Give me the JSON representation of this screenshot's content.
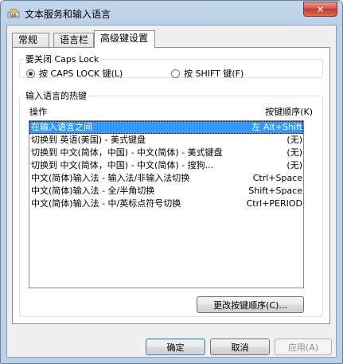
{
  "window": {
    "title": "文本服务和输入语言",
    "close_label": "✕"
  },
  "tabs": [
    {
      "label": "常规",
      "active": false
    },
    {
      "label": "语言栏",
      "active": false
    },
    {
      "label": "高级键设置",
      "active": true
    }
  ],
  "caps_lock": {
    "legend": "要关闭 Caps Lock",
    "option1": "按 CAPS LOCK 键(L)",
    "option2": "按 SHIFT 键(F)",
    "selected": "option1"
  },
  "hotkeys": {
    "legend": "输入语言的热键",
    "col_action": "操作",
    "col_sequence": "按键顺序(K)",
    "rows": [
      {
        "action": "在输入语言之间",
        "keys": "左 Alt+Shift",
        "selected": true
      },
      {
        "action": "切换到 英语(美国) - 美式键盘",
        "keys": "(无)",
        "selected": false
      },
      {
        "action": "切换到 中文(简体，中国) - 中文(简体) - 美式键盘",
        "keys": "(无)",
        "selected": false
      },
      {
        "action": "切换到 中文(简体，中国) - 中文(简体) - 搜狗...",
        "keys": "(无)",
        "selected": false
      },
      {
        "action": "中文(简体)输入法 - 输入法/非输入法切换",
        "keys": "Ctrl+Space",
        "selected": false
      },
      {
        "action": "中文(简体)输入法 - 全/半角切换",
        "keys": "Shift+Space",
        "selected": false
      },
      {
        "action": "中文(简体)输入法 - 中/英标点符号切换",
        "keys": "Ctrl+PERIOD",
        "selected": false
      }
    ],
    "change_button": "更改按键顺序(C)..."
  },
  "footer": {
    "ok": "确定",
    "cancel": "取消",
    "apply": "应用(A)"
  },
  "colors": {
    "selection": "#3399ff",
    "title_gradient": "#bcd1e8"
  }
}
